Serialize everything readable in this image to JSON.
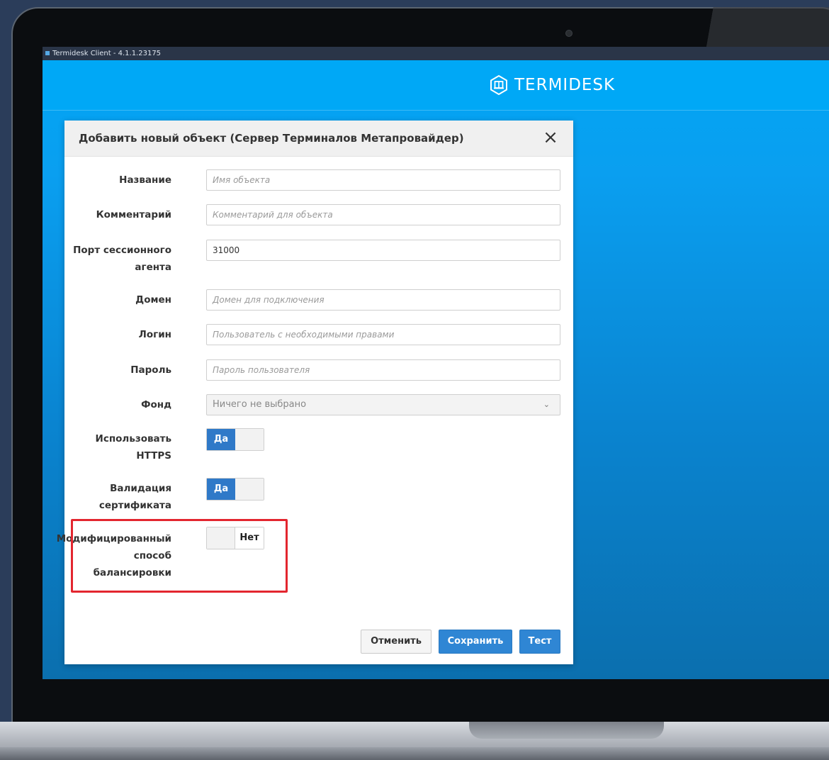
{
  "window": {
    "title": "Termidesk Client - 4.1.1.23175"
  },
  "brand": {
    "logo_text": "TERMIDESK",
    "accent": "#00a8f6"
  },
  "dialog": {
    "title": "Добавить новый объект (Сервер Терминалов Метапровайдер)",
    "close_icon": "×",
    "fields": {
      "name": {
        "label": "Название",
        "placeholder": "Имя объекта"
      },
      "comment": {
        "label": "Комментарий",
        "placeholder": "Комментарий для объекта"
      },
      "port": {
        "label_line1": "Порт сессионного",
        "label_line2": "агента",
        "value": "31000"
      },
      "domain": {
        "label": "Домен",
        "placeholder": "Домен для подключения"
      },
      "login": {
        "label": "Логин",
        "placeholder": "Пользователь с необходимыми правами"
      },
      "password": {
        "label": "Пароль",
        "placeholder": "Пароль пользователя"
      },
      "fund": {
        "label": "Фонд",
        "value": "Ничего не выбрано"
      },
      "https": {
        "label_line1": "Использовать",
        "label_line2": "HTTPS",
        "toggle": "Да"
      },
      "cert": {
        "label_line1": "Валидация",
        "label_line2": "сертификата",
        "toggle": "Да"
      },
      "balancing": {
        "label_line1": "Модифицированный",
        "label_line2": "способ",
        "label_line3": "балансировки",
        "toggle": "Нет"
      }
    },
    "buttons": {
      "cancel": "Отменить",
      "save": "Сохранить",
      "test": "Тест"
    }
  }
}
